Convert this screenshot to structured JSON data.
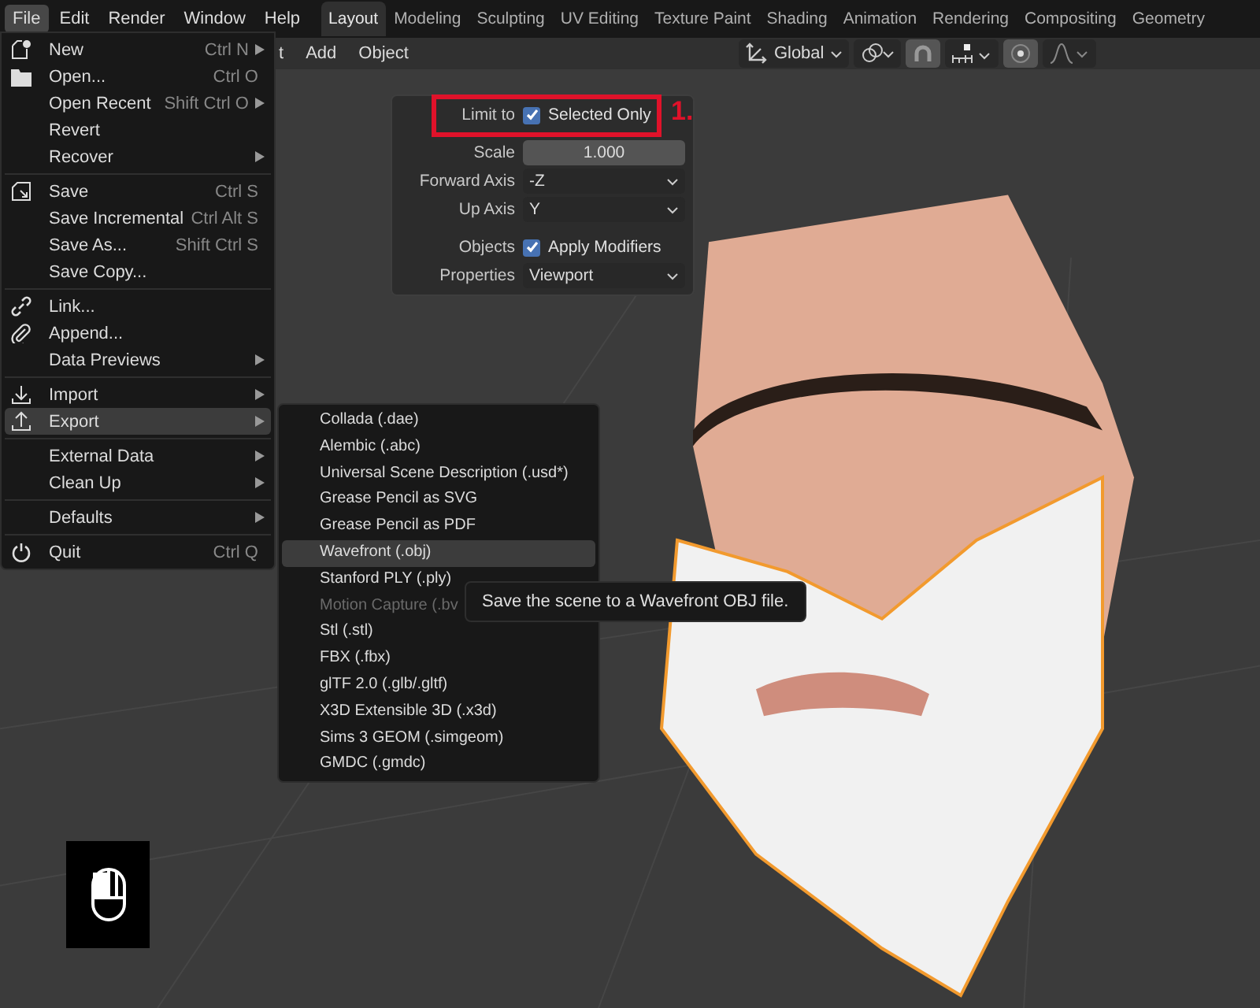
{
  "menubar": [
    {
      "label": "File",
      "selected": true
    },
    {
      "label": "Edit",
      "selected": false
    },
    {
      "label": "Render",
      "selected": false
    },
    {
      "label": "Window",
      "selected": false
    },
    {
      "label": "Help",
      "selected": false
    }
  ],
  "workspace_tabs": [
    {
      "label": "Layout",
      "selected": true
    },
    {
      "label": "Modeling",
      "selected": false
    },
    {
      "label": "Sculpting",
      "selected": false
    },
    {
      "label": "UV Editing",
      "selected": false
    },
    {
      "label": "Texture Paint",
      "selected": false
    },
    {
      "label": "Shading",
      "selected": false
    },
    {
      "label": "Animation",
      "selected": false
    },
    {
      "label": "Rendering",
      "selected": false
    },
    {
      "label": "Compositing",
      "selected": false
    },
    {
      "label": "Geometry",
      "selected": false
    }
  ],
  "header_menu": [
    "t",
    "Add",
    "Object"
  ],
  "toolbar": {
    "orientation": "Global"
  },
  "file_menu": [
    [
      {
        "label": "New",
        "shortcut": "Ctrl N",
        "submenu": true,
        "selected": false
      },
      {
        "label": "Open...",
        "shortcut": "Ctrl O",
        "submenu": false,
        "selected": false
      },
      {
        "label": "Open Recent",
        "shortcut": "Shift Ctrl O",
        "submenu": true,
        "selected": false
      },
      {
        "label": "Revert",
        "submenu": false,
        "selected": false
      },
      {
        "label": "Recover",
        "submenu": true,
        "selected": false
      }
    ],
    [
      {
        "label": "Save",
        "shortcut": "Ctrl S",
        "submenu": false,
        "selected": false
      },
      {
        "label": "Save Incremental",
        "shortcut": "Ctrl Alt S",
        "submenu": false,
        "selected": false
      },
      {
        "label": "Save As...",
        "shortcut": "Shift Ctrl S",
        "submenu": false,
        "selected": false
      },
      {
        "label": "Save Copy...",
        "submenu": false,
        "selected": false
      }
    ],
    [
      {
        "label": "Link...",
        "submenu": false,
        "selected": false
      },
      {
        "label": "Append...",
        "submenu": false,
        "selected": false
      },
      {
        "label": "Data Previews",
        "submenu": true,
        "selected": false
      }
    ],
    [
      {
        "label": "Import",
        "submenu": true,
        "selected": false
      },
      {
        "label": "Export",
        "submenu": true,
        "selected": true
      }
    ],
    [
      {
        "label": "External Data",
        "submenu": true,
        "selected": false
      },
      {
        "label": "Clean Up",
        "submenu": true,
        "selected": false
      }
    ],
    [
      {
        "label": "Defaults",
        "submenu": true,
        "selected": false
      }
    ],
    [
      {
        "label": "Quit",
        "shortcut": "Ctrl Q",
        "submenu": false,
        "selected": false
      }
    ]
  ],
  "export_menu": [
    {
      "label": "Collada (.dae)",
      "selected": false,
      "disabled": false
    },
    {
      "label": "Alembic (.abc)",
      "selected": false,
      "disabled": false
    },
    {
      "label": "Universal Scene Description (.usd*)",
      "selected": false,
      "disabled": false
    },
    {
      "label": "Grease Pencil as SVG",
      "selected": false,
      "disabled": false
    },
    {
      "label": "Grease Pencil as PDF",
      "selected": false,
      "disabled": false
    },
    {
      "label": "Wavefront (.obj)",
      "selected": true,
      "disabled": false
    },
    {
      "label": "Stanford PLY (.ply)",
      "selected": false,
      "disabled": false
    },
    {
      "label": "Motion Capture (.bv",
      "selected": false,
      "disabled": true
    },
    {
      "label": "Stl (.stl)",
      "selected": false,
      "disabled": false
    },
    {
      "label": "FBX (.fbx)",
      "selected": false,
      "disabled": false
    },
    {
      "label": "glTF 2.0 (.glb/.gltf)",
      "selected": false,
      "disabled": false
    },
    {
      "label": "X3D Extensible 3D (.x3d)",
      "selected": false,
      "disabled": false
    },
    {
      "label": "Sims 3 GEOM (.simgeom)",
      "selected": false,
      "disabled": false
    },
    {
      "label": "GMDC (.gmdc)",
      "selected": false,
      "disabled": false
    }
  ],
  "tooltip": "Save the scene to a Wavefront OBJ file.",
  "export_panel": {
    "groups": [
      [
        {
          "label": "Limit to",
          "kind": "checkbox",
          "text": "Selected Only",
          "checked": true
        },
        {
          "label": "Scale",
          "kind": "number",
          "value": "1.000"
        },
        {
          "label": "Forward Axis",
          "kind": "dropdown",
          "value": "-Z"
        },
        {
          "label": "Up Axis",
          "kind": "dropdown",
          "value": "Y"
        }
      ],
      [
        {
          "label": "Objects",
          "kind": "checkbox",
          "text": "Apply Modifiers",
          "checked": true
        },
        {
          "label": "Properties",
          "kind": "dropdown",
          "value": "Viewport"
        }
      ]
    ]
  },
  "annotation": {
    "label": "1."
  },
  "viewport": {
    "kind": "picture"
  }
}
